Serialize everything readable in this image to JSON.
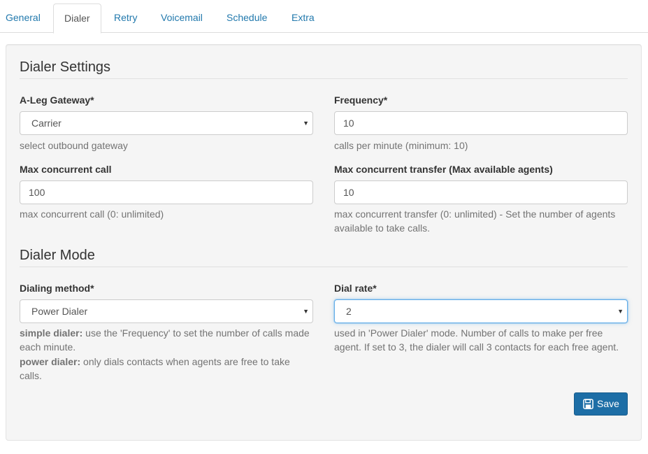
{
  "tabs": [
    {
      "label": "General"
    },
    {
      "label": "Dialer"
    },
    {
      "label": "Retry"
    },
    {
      "label": "Voicemail"
    },
    {
      "label": "Schedule"
    },
    {
      "label": "Extra"
    }
  ],
  "active_tab": "Dialer",
  "dialer_settings": {
    "title": "Dialer Settings",
    "a_leg_gateway": {
      "label": "A-Leg Gateway*",
      "value": "Carrier",
      "help": "select outbound gateway"
    },
    "frequency": {
      "label": "Frequency*",
      "value": "10",
      "help": "calls per minute (minimum: 10)"
    },
    "max_concurrent_call": {
      "label": "Max concurrent call",
      "value": "100",
      "help": "max concurrent call (0: unlimited)"
    },
    "max_concurrent_transfer": {
      "label": "Max concurrent transfer (Max available agents)",
      "value": "10",
      "help_line1": "max concurrent transfer (0: unlimited) - Set the number of agents",
      "help_line2": "available to take calls."
    }
  },
  "dialer_mode": {
    "title": "Dialer Mode",
    "dialing_method": {
      "label": "Dialing method*",
      "value": "Power Dialer",
      "help_simple_strong": "simple dialer:",
      "help_simple_line1": " use the 'Frequency' to set the number of calls made",
      "help_simple_line2": "each minute.",
      "help_power_strong": "power dialer:",
      "help_power_line1": " only dials contacts when agents are free to take",
      "help_power_line2": "calls."
    },
    "dial_rate": {
      "label": "Dial rate*",
      "value": "2",
      "help_line1": "used in 'Power Dialer' mode. Number of calls to make per free",
      "help_line2": "agent. If set to 3, the dialer will call 3 contacts for each free agent."
    }
  },
  "save_button": {
    "label": "Save",
    "icon": "save-icon",
    "color": "#1d6ea6"
  },
  "colors": {
    "link": "#2279ad",
    "panel_bg": "#f5f5f5",
    "focus_border": "#66afe9"
  }
}
